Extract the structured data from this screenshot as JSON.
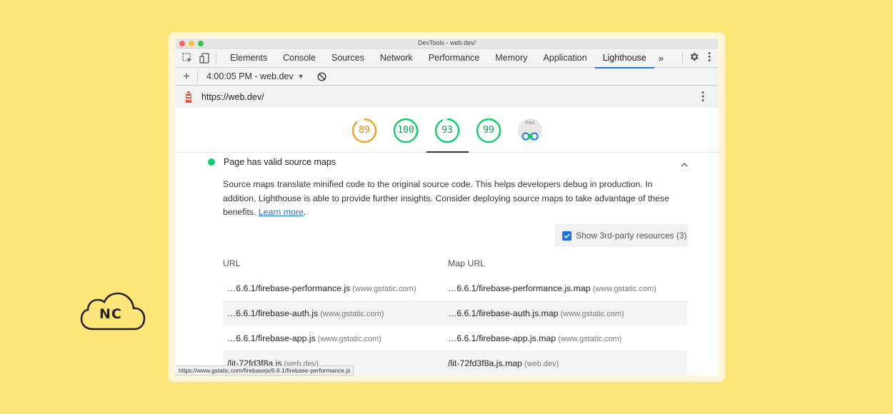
{
  "window_title": "DevTools - web.dev/",
  "tabs": [
    {
      "label": "Elements",
      "active": false
    },
    {
      "label": "Console",
      "active": false
    },
    {
      "label": "Sources",
      "active": false
    },
    {
      "label": "Network",
      "active": false
    },
    {
      "label": "Performance",
      "active": false
    },
    {
      "label": "Memory",
      "active": false
    },
    {
      "label": "Application",
      "active": false
    },
    {
      "label": "Lighthouse",
      "active": true
    }
  ],
  "more_tabs": "»",
  "report": {
    "selected": "4:00:05 PM - web.dev"
  },
  "url": "https://web.dev/",
  "gauges": [
    {
      "score": "89",
      "color": "#f4a126"
    },
    {
      "score": "100",
      "color": "#0cce6b"
    },
    {
      "score": "93",
      "color": "#0cce6b"
    },
    {
      "score": "99",
      "color": "#0cce6b"
    }
  ],
  "pwa_badge": "PWA",
  "audit": {
    "title": "Page has valid source maps",
    "description": "Source maps translate minified code to the original source code. This helps developers debug in production. In addition, Lighthouse is able to provide further insights. Consider deploying source maps to take advantage of these benefits.",
    "learn_more": "Learn more",
    "third_party_label": "Show 3rd-party resources (3)",
    "third_party_checked": true
  },
  "table": {
    "headers": [
      "URL",
      "Map URL"
    ],
    "rows": [
      {
        "url": "…6.6.1/firebase-performance.js",
        "url_host": "(www.gstatic.com)",
        "map": "…6.6.1/firebase-performance.js.map",
        "map_host": "(www.gstatic.com)"
      },
      {
        "url": "…6.6.1/firebase-auth.js",
        "url_host": "(www.gstatic.com)",
        "map": "…6.6.1/firebase-auth.js.map",
        "map_host": "(www.gstatic.com)"
      },
      {
        "url": "…6.6.1/firebase-app.js",
        "url_host": "(www.gstatic.com)",
        "map": "…6.6.1/firebase-app.js.map",
        "map_host": "(www.gstatic.com)"
      },
      {
        "url": "/lit-72fd3f8a.js",
        "url_host": "(web.dev)",
        "map": "/lit-72fd3f8a.js.map",
        "map_host": "(web.dev)"
      }
    ]
  },
  "status_url": "https://www.gstatic.com/firebasejs/6.6.1/firebase-performance.js",
  "logo_text": "NC",
  "colors": {
    "background": "#fde677",
    "accent": "#1a73e8",
    "pass": "#0cce6b",
    "average": "#f4a126"
  }
}
